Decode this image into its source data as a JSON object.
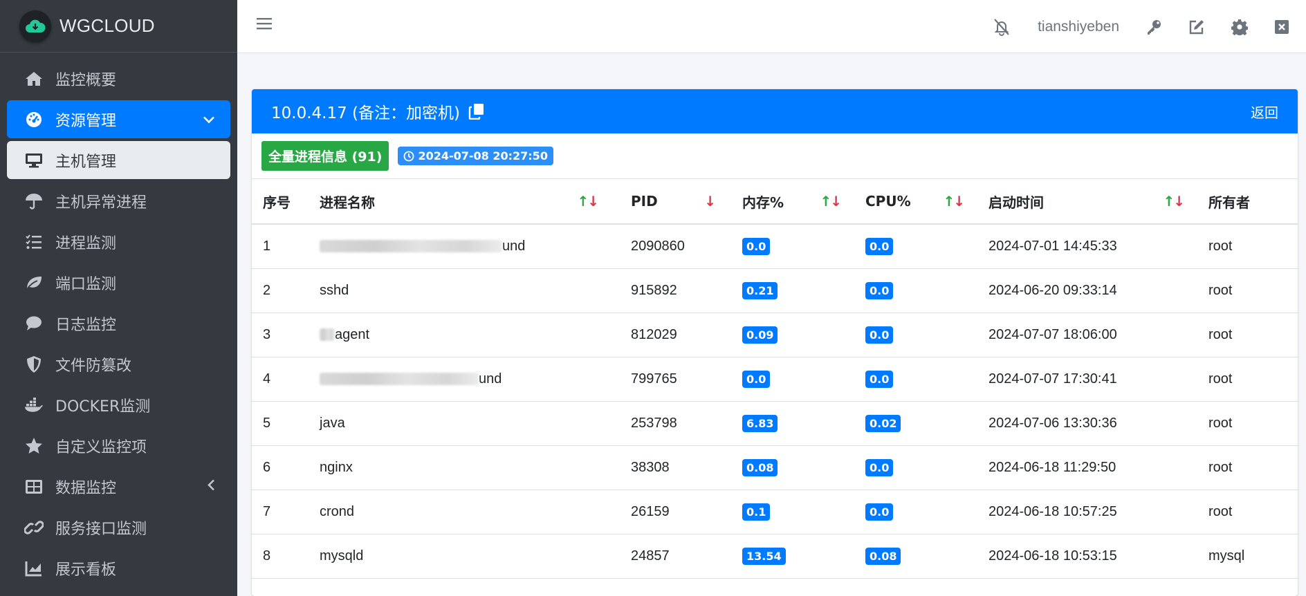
{
  "brand": {
    "name": "WGCLOUD"
  },
  "sidebar": {
    "items": [
      {
        "label": "监控概要",
        "icon": "home-icon"
      },
      {
        "label": "资源管理",
        "icon": "dashboard-icon"
      },
      {
        "label": "主机管理",
        "icon": "desktop-icon"
      },
      {
        "label": "主机异常进程",
        "icon": "umbrella-icon"
      },
      {
        "label": "进程监测",
        "icon": "list-icon"
      },
      {
        "label": "端口监测",
        "icon": "leaf-icon"
      },
      {
        "label": "日志监控",
        "icon": "comment-icon"
      },
      {
        "label": "文件防篡改",
        "icon": "shield-icon"
      },
      {
        "label": "DOCKER监测",
        "icon": "docker-icon"
      },
      {
        "label": "自定义监控项",
        "icon": "star-icon"
      },
      {
        "label": "数据监控",
        "icon": "table-icon"
      },
      {
        "label": "服务接口监测",
        "icon": "link-icon"
      },
      {
        "label": "展示看板",
        "icon": "chart-icon"
      }
    ]
  },
  "topbar": {
    "username": "tianshiyeben"
  },
  "card": {
    "title": "10.0.4.17 (备注：加密机)",
    "back_label": "返回",
    "process_badge": "全量进程信息 (91)",
    "time_badge": "2024-07-08 20:27:50"
  },
  "table": {
    "headers": {
      "index": "序号",
      "name": "进程名称",
      "pid": "PID",
      "mem": "内存%",
      "cpu": "CPU%",
      "start": "启动时间",
      "owner": "所有者"
    },
    "rows": [
      {
        "index": "1",
        "name": "und",
        "pid": "2090860",
        "mem": "0.0",
        "cpu": "0.0",
        "start": "2024-07-01 14:45:33",
        "owner": "root"
      },
      {
        "index": "2",
        "name": "sshd",
        "pid": "915892",
        "mem": "0.21",
        "cpu": "0.0",
        "start": "2024-06-20 09:33:14",
        "owner": "root"
      },
      {
        "index": "3",
        "name": "agent",
        "pid": "812029",
        "mem": "0.09",
        "cpu": "0.0",
        "start": "2024-07-07 18:06:00",
        "owner": "root"
      },
      {
        "index": "4",
        "name": "und",
        "pid": "799765",
        "mem": "0.0",
        "cpu": "0.0",
        "start": "2024-07-07 17:30:41",
        "owner": "root"
      },
      {
        "index": "5",
        "name": "java",
        "pid": "253798",
        "mem": "6.83",
        "cpu": "0.02",
        "start": "2024-07-06 13:30:36",
        "owner": "root"
      },
      {
        "index": "6",
        "name": "nginx",
        "pid": "38308",
        "mem": "0.08",
        "cpu": "0.0",
        "start": "2024-06-18 11:29:50",
        "owner": "root"
      },
      {
        "index": "7",
        "name": "crond",
        "pid": "26159",
        "mem": "0.1",
        "cpu": "0.0",
        "start": "2024-06-18 10:57:25",
        "owner": "root"
      },
      {
        "index": "8",
        "name": "mysqld",
        "pid": "24857",
        "mem": "13.54",
        "cpu": "0.08",
        "start": "2024-06-18 10:53:15",
        "owner": "mysql"
      }
    ]
  }
}
